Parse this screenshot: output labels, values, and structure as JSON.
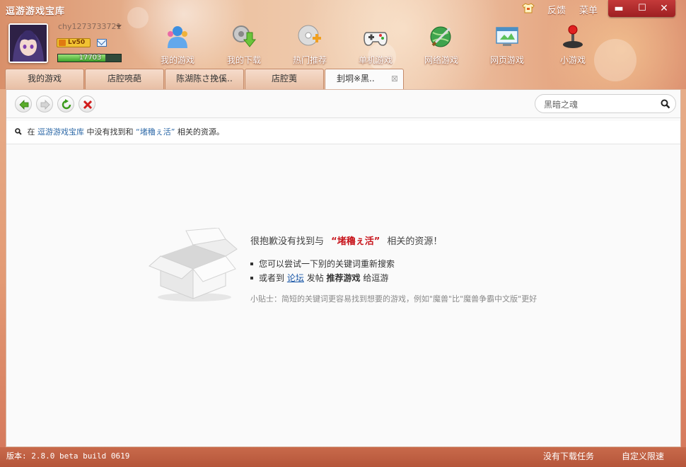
{
  "app": {
    "title": "逗游游戏宝库"
  },
  "topbar": {
    "feedback": "反馈",
    "menu": "菜单",
    "minimize": "▬",
    "maximize": "☐",
    "close": "✕"
  },
  "user": {
    "name": "chy1273733721",
    "level": "Lv50",
    "exp_text": "17703",
    "exp_fraction": 0.75
  },
  "nav": [
    {
      "label": "我的游戏",
      "icon": "user-group-icon"
    },
    {
      "label": "我的下载",
      "icon": "download-gear-icon"
    },
    {
      "label": "热门推荐",
      "icon": "disc-plus-icon"
    },
    {
      "label": "单机游戏",
      "icon": "gamepad-icon"
    },
    {
      "label": "网络游戏",
      "icon": "globe-sword-icon"
    },
    {
      "label": "网页游戏",
      "icon": "web-screen-icon"
    },
    {
      "label": "小游戏",
      "icon": "joystick-icon"
    }
  ],
  "tabs": [
    {
      "label": "我的游戏"
    },
    {
      "label": "店腔喨葩"
    },
    {
      "label": "陈湖陈さ挽傒.."
    },
    {
      "label": "店腔荑"
    },
    {
      "label": "刲垌※黑.."
    }
  ],
  "search": {
    "value": "黑暗之魂"
  },
  "result_bar": {
    "prefix": "在",
    "app": "逗游游戏宝库",
    "mid": "中没有找到和",
    "keyword": "“堵穭ぇ活”",
    "suffix": "相关的资源。"
  },
  "message": {
    "title_prefix": "很抱歉没有找到与",
    "keyword": "“堵穭ぇ活”",
    "title_suffix": "相关的资源！",
    "bullet1": "您可以尝试一下别的关键词重新搜索",
    "bullet2_prefix": "或者到",
    "forum_link": "论坛",
    "bullet2_mid": "发帖",
    "recommend": "推荐游戏",
    "bullet2_suffix": "给逗游",
    "tip": "小贴士：简短的关键词更容易找到想要的游戏，例如\"魔兽\"比\"魔兽争霸中文版\"更好"
  },
  "status": {
    "version": "版本: 2.8.0 beta build 0619",
    "no_tasks": "没有下载任务",
    "speed_limit": "自定义限速"
  }
}
